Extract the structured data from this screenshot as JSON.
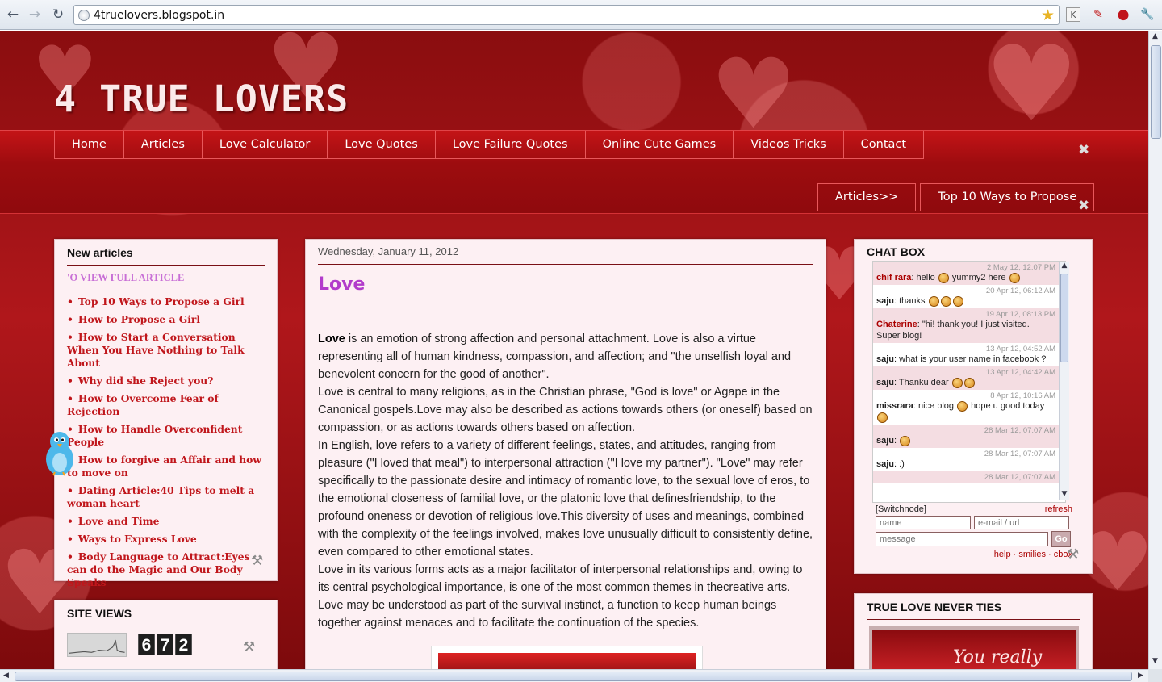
{
  "browser": {
    "url": "4truelovers.blogspot.in",
    "back": "←",
    "forward": "→",
    "reload": "↻",
    "star": "★",
    "ext_k": "K",
    "ext_2": "✎",
    "ext_3": "●",
    "wrench": "🔧"
  },
  "blog": {
    "title": "4 TRUE LOVERS"
  },
  "menu": {
    "items": [
      "Home",
      "Articles",
      "Love Calculator",
      "Love Quotes",
      "Love Failure Quotes",
      "Online Cute Games",
      "Videos Tricks",
      "Contact"
    ],
    "close": "✖"
  },
  "submenu": {
    "items": [
      "Articles>>",
      "Top 10 Ways to Propose"
    ],
    "close": "✖"
  },
  "new_articles": {
    "title": "New articles",
    "full_link": "'O VIEW FULL ARTICLE",
    "articles": [
      "Top 10 Ways to Propose a Girl",
      "How to Propose a Girl",
      "How to Start a Conversation When You Have Nothing to Talk About",
      "Why did she Reject you?",
      "How to Overcome Fear of Rejection",
      "How to Handle Overconfident People",
      "How to forgive an Affair and how to move on",
      "Dating Article:40 Tips to melt a woman heart",
      "Love and Time",
      "Ways to Express Love",
      "Body Language to Attract:Eyes can do the Magic and Our Body Speaks"
    ],
    "tools": "⚒"
  },
  "site_views": {
    "title": "SITE VIEWS",
    "digits": [
      "6",
      "7",
      "2"
    ],
    "tools": "⚒"
  },
  "post": {
    "date": "Wednesday, January 11, 2012",
    "title": "Love",
    "lead_word": "Love",
    "p1_rest": " is an emotion of strong affection and personal attachment. Love is also a virtue representing all of human kindness, compassion, and affection; and \"the unselfish loyal and benevolent concern for the good of another\".",
    "p2": "Love is central to many religions, as in the Christian phrase, \"God is love\" or Agape in the Canonical gospels.Love may also be described as actions towards others (or oneself) based on compassion, or as actions towards others based on affection.",
    "p3": "In English, love refers to a variety of different feelings, states, and attitudes, ranging from pleasure (\"I loved that meal\") to interpersonal attraction (\"I love my partner\"). \"Love\" may refer specifically to the passionate desire and intimacy of romantic love, to the sexual love of eros, to the emotional closeness of familial love, or the platonic love that definesfriendship, to the profound oneness or devotion of religious love.This diversity of uses and meanings, combined with the complexity of the feelings involved, makes love unusually difficult to consistently define, even compared to other emotional states.",
    "p4": "Love in its various forms acts as a major facilitator of interpersonal relationships and, owing to its central psychological importance, is one of the most common themes in thecreative arts.",
    "p5": "Love may be understood as part of the survival instinct, a function to keep human beings together against menaces and to facilitate the continuation of the species."
  },
  "chat": {
    "title": "CHAT BOX",
    "messages": [
      {
        "time": "2 May 12, 12:07 PM",
        "who": "chif rara",
        "text": ": hello ",
        "text2": " yummy2 here ",
        "smiles_a": 1,
        "smiles_b": 1
      },
      {
        "time": "20 Apr 12, 06:12 AM",
        "who": "saju",
        "text": ": thanks ",
        "text2": "",
        "smiles_a": 3,
        "smiles_b": 0
      },
      {
        "time": "19 Apr 12, 08:13 PM",
        "who": "Chaterine",
        "text": ": \"hi! thank you! I just visited. Super blog!",
        "text2": "",
        "smiles_a": 0,
        "smiles_b": 0
      },
      {
        "time": "13 Apr 12, 04:52 AM",
        "who": "saju",
        "text": ": what is your user name in facebook ?",
        "text2": "",
        "smiles_a": 0,
        "smiles_b": 0
      },
      {
        "time": "13 Apr 12, 04:42 AM",
        "who": "saju",
        "text": ": Thanku dear ",
        "text2": "",
        "smiles_a": 2,
        "smiles_b": 0
      },
      {
        "time": "8 Apr 12, 10:16 AM",
        "who": "missrara",
        "text": ": nice blog ",
        "text2": " hope u good today ",
        "smiles_a": 1,
        "smiles_b": 1
      },
      {
        "time": "28 Mar 12, 07:07 AM",
        "who": "saju",
        "text": ": ",
        "text2": "",
        "smiles_a": 1,
        "smiles_b": 0
      },
      {
        "time": "28 Mar 12, 07:07 AM",
        "who": "saju",
        "text": ": :)",
        "text2": "",
        "smiles_a": 0,
        "smiles_b": 0
      },
      {
        "time": "28 Mar 12, 07:07 AM",
        "who": "",
        "text": "",
        "text2": "",
        "smiles_a": 0,
        "smiles_b": 0
      }
    ],
    "switchnode": "[Switchnode]",
    "refresh": "refresh",
    "name_placeholder": "name",
    "email_placeholder": "e-mail / url",
    "message_placeholder": "message",
    "go": "Go",
    "footer": "help · smilies · cbox",
    "scroll_up": "▲",
    "scroll_down": "▼",
    "tools": "⚒"
  },
  "true_love": {
    "title": "TRUE LOVE NEVER TIES",
    "image_text": "You really"
  },
  "scrollbars": {
    "up": "▲",
    "down": "▼",
    "left": "◀",
    "right": "▶"
  }
}
